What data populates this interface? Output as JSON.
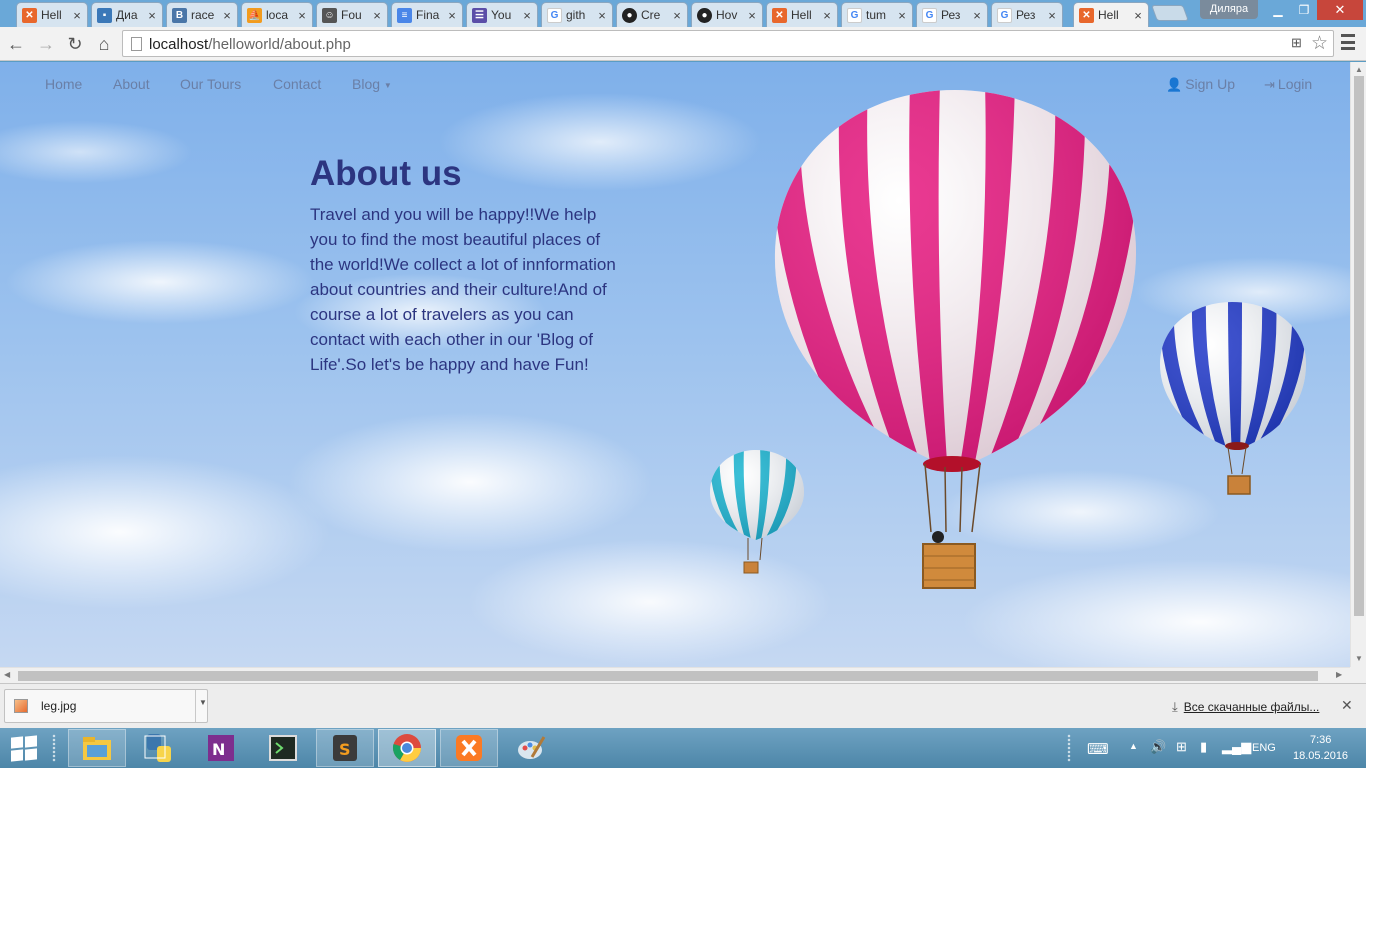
{
  "browser": {
    "tabs": [
      {
        "title": "Hell",
        "favicon": "xampp-icon",
        "color": "#e8672c"
      },
      {
        "title": "Диа",
        "favicon": "chat-icon",
        "color": "#3b78b8"
      },
      {
        "title": "race",
        "favicon": "vk-icon",
        "color": "#4a76a8"
      },
      {
        "title": "loca",
        "favicon": "phpmyadmin-icon",
        "color": "#f29b1d"
      },
      {
        "title": "Fou",
        "favicon": "contact-icon",
        "color": "#555555"
      },
      {
        "title": "Fina",
        "favicon": "docs-icon",
        "color": "#4a86e8"
      },
      {
        "title": "You",
        "favicon": "list-icon",
        "color": "#5b4ea8"
      },
      {
        "title": "gith",
        "favicon": "google-icon",
        "color": "#4285f4"
      },
      {
        "title": "Cre",
        "favicon": "github-icon",
        "color": "#222222"
      },
      {
        "title": "Hov",
        "favicon": "github-icon",
        "color": "#222222"
      },
      {
        "title": "Hell",
        "favicon": "xampp-icon",
        "color": "#e8672c"
      },
      {
        "title": "tum",
        "favicon": "google-icon",
        "color": "#4285f4"
      },
      {
        "title": "Рез",
        "favicon": "google-icon",
        "color": "#4285f4"
      },
      {
        "title": "Рез",
        "favicon": "google-icon",
        "color": "#4285f4"
      },
      {
        "title": "Hell",
        "favicon": "xampp-icon",
        "color": "#e8672c"
      }
    ],
    "user_name": "Диляра",
    "url_host": "localhost",
    "url_path": "/helloworld/about.php"
  },
  "site": {
    "nav": {
      "home": "Home",
      "about": "About",
      "tours": "Our Tours",
      "contact": "Contact",
      "blog": "Blog",
      "signup": "Sign Up",
      "login": "Login"
    },
    "title": "About us",
    "text": "Travel and you will be happy!!We help you to find the most beautiful places of the world!We collect a lot of innformation about countries and their culture!And of course a lot of travelers as you can contact with each other in our 'Blog of Life'.So let's be happy and have Fun!"
  },
  "downloads": {
    "file_name": "leg.jpg",
    "show_all": "Все скачанные файлы..."
  },
  "taskbar": {
    "apps": [
      "file-explorer-icon",
      "python-icon",
      "onenote-icon",
      "terminal-icon",
      "sublime-text-icon",
      "chrome-icon",
      "xampp-icon",
      "paint-icon"
    ],
    "language": "ENG",
    "time": "7:36",
    "date": "18.05.2016"
  },
  "colors": {
    "site_text": "#2c3580",
    "nav_link": "#6a7fa6",
    "balloon_pink": "#e6177e",
    "balloon_blue": "#1f36c8",
    "balloon_teal": "#19b5d0"
  }
}
